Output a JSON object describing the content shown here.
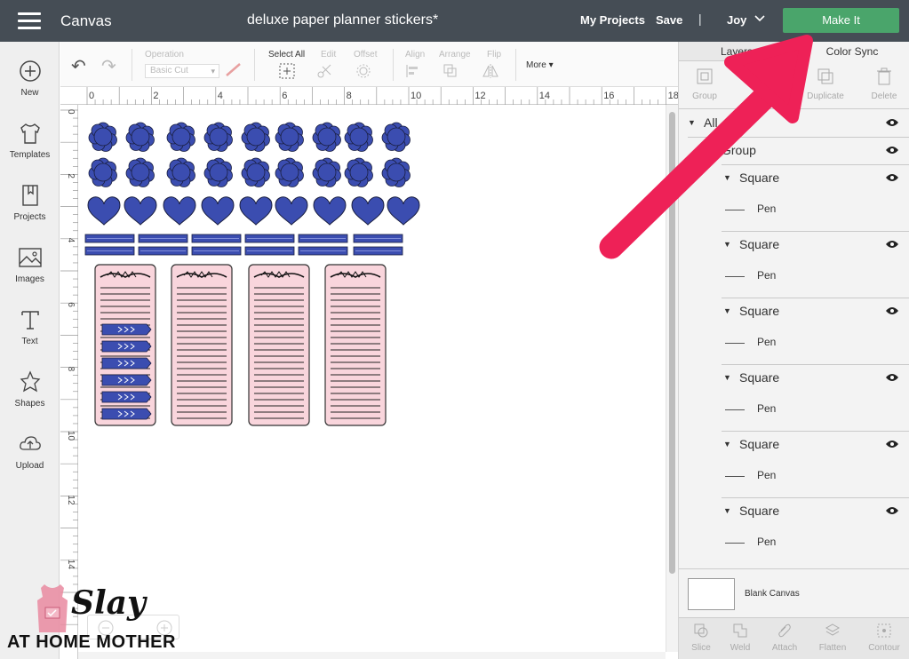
{
  "topbar": {
    "app_title": "Canvas",
    "doc_title": "deluxe paper planner stickers*",
    "my_projects": "My Projects",
    "save": "Save",
    "separator": "|",
    "user": "Joy",
    "make_it": "Make It",
    "make_it_color": "#4aa56b"
  },
  "sidebar": {
    "items": [
      {
        "label": "New",
        "icon": "plus-circle-icon"
      },
      {
        "label": "Templates",
        "icon": "tshirt-icon"
      },
      {
        "label": "Projects",
        "icon": "bookmark-book-icon"
      },
      {
        "label": "Images",
        "icon": "image-icon"
      },
      {
        "label": "Text",
        "icon": "text-T-icon"
      },
      {
        "label": "Shapes",
        "icon": "shapes-icon"
      },
      {
        "label": "Upload",
        "icon": "cloud-upload-icon"
      }
    ]
  },
  "toolbar": {
    "operation_label": "Operation",
    "operation_value": "Basic Cut",
    "select_all": "Select All",
    "edit": "Edit",
    "offset": "Offset",
    "align": "Align",
    "arrange": "Arrange",
    "flip": "Flip",
    "more": "More"
  },
  "rulers": {
    "top": [
      "0",
      "2",
      "4",
      "6",
      "8",
      "10",
      "12",
      "14",
      "16",
      "18"
    ],
    "left": [
      "0",
      "2",
      "4",
      "6",
      "8",
      "10",
      "12",
      "14"
    ]
  },
  "panel": {
    "tabs": [
      "Layers",
      "Color Sync"
    ],
    "tools": [
      "Group",
      "Duplicate",
      "Delete"
    ],
    "layers": {
      "root": "All",
      "group": "Group",
      "items": [
        {
          "name": "Square",
          "child": "Pen"
        },
        {
          "name": "Square",
          "child": "Pen"
        },
        {
          "name": "Square",
          "child": "Pen"
        },
        {
          "name": "Square",
          "child": "Pen"
        },
        {
          "name": "Square",
          "child": "Pen"
        },
        {
          "name": "Square",
          "child": "Pen"
        }
      ]
    },
    "blank_canvas": "Blank Canvas",
    "bottom_tools": [
      "Slice",
      "Weld",
      "Attach",
      "Flatten",
      "Contour"
    ]
  },
  "colors": {
    "sticker_blue": "#3b4db0",
    "notes_pink": "#f9d5dc",
    "arrow_pink": "#ee2157"
  },
  "watermark": {
    "script": "Slay",
    "sub": "AT HOME MOTHER"
  }
}
